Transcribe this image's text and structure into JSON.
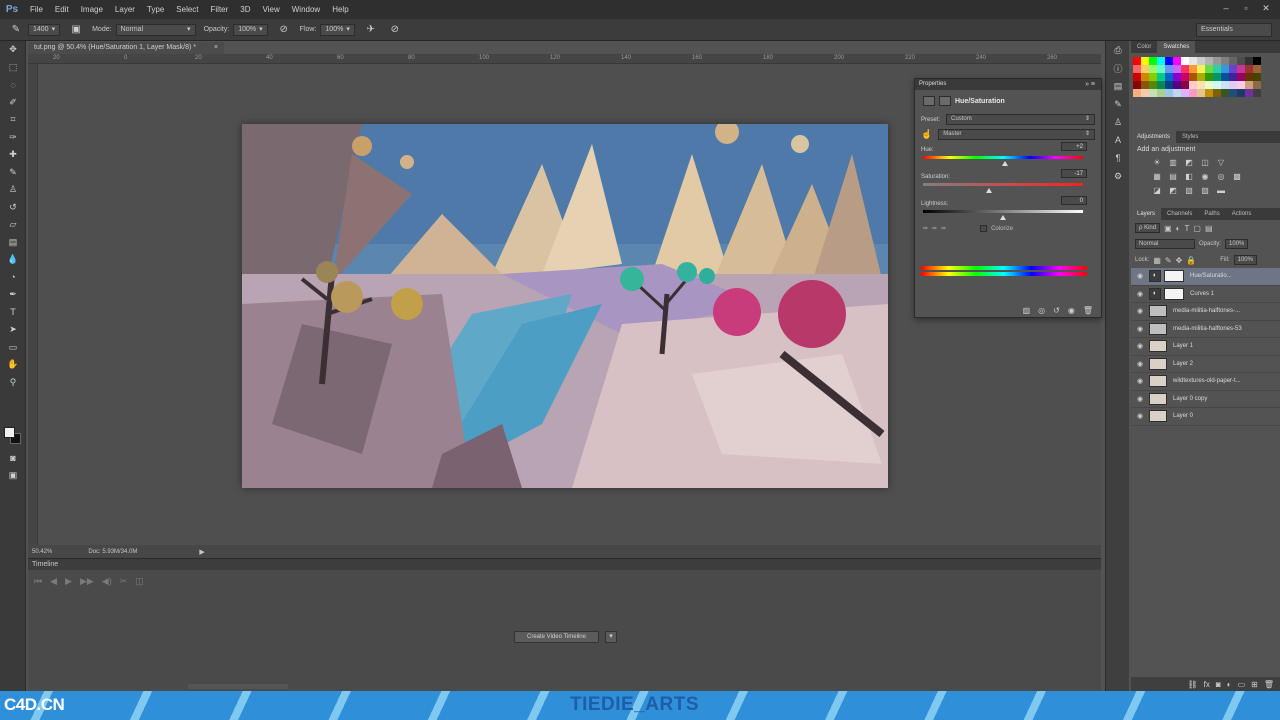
{
  "app": {
    "logo": "Ps"
  },
  "menu": [
    "File",
    "Edit",
    "Image",
    "Layer",
    "Type",
    "Select",
    "Filter",
    "3D",
    "View",
    "Window",
    "Help"
  ],
  "window_controls": [
    "–",
    "▫",
    "✕"
  ],
  "options_bar": {
    "brush_size": "1400",
    "mode_label": "Mode:",
    "mode_value": "Normal",
    "opacity_label": "Opacity:",
    "opacity_value": "100%",
    "flow_label": "Flow:",
    "flow_value": "100%",
    "workspace": "Essentials"
  },
  "document": {
    "tab_title": "tut.png @ 50.4% (Hue/Saturation 1, Layer Mask/8) *",
    "tab_close": "×",
    "ruler_ticks": [
      "20",
      "0",
      "20",
      "40",
      "60",
      "80",
      "100",
      "120",
      "140",
      "160",
      "180",
      "200",
      "220",
      "240",
      "260"
    ]
  },
  "status": {
    "zoom": "50.42%",
    "doc": "Doc: 5.93M/34.0M"
  },
  "timeline": {
    "title": "Timeline",
    "create_button": "Create Video Timeline"
  },
  "swatches_panel": {
    "tabs": [
      "Color",
      "Swatches"
    ],
    "colors": [
      "#ff0000",
      "#ffff00",
      "#00ff00",
      "#00ffff",
      "#0000ff",
      "#ff00ff",
      "#ffffff",
      "#e6e6e6",
      "#cccccc",
      "#b3b3b3",
      "#999999",
      "#808080",
      "#666666",
      "#4d4d4d",
      "#333333",
      "#000000",
      "#ff6666",
      "#ffcc66",
      "#99ff66",
      "#66ffcc",
      "#6699ff",
      "#cc66ff",
      "#ff3366",
      "#ff9933",
      "#ffee55",
      "#66dd44",
      "#33ccaa",
      "#3399dd",
      "#6644cc",
      "#cc3399",
      "#993333",
      "#996633",
      "#cc0000",
      "#cc8800",
      "#88cc00",
      "#00cc88",
      "#0066cc",
      "#8800cc",
      "#cc0066",
      "#aa5500",
      "#aaaa00",
      "#339900",
      "#009966",
      "#005599",
      "#442299",
      "#990066",
      "#663300",
      "#444400",
      "#880000",
      "#885500",
      "#558800",
      "#008855",
      "#004488",
      "#550088",
      "#880044",
      "#ffcccc",
      "#ffe0b3",
      "#e6ffcc",
      "#ccffee",
      "#cce0ff",
      "#e0ccff",
      "#ffcce6",
      "#c8a27a",
      "#8a6a4a",
      "#f4b183",
      "#f8cbad",
      "#c5e0b4",
      "#a9d18e",
      "#9dc3e6",
      "#bdd7ee",
      "#d9b3ff",
      "#ff99cc",
      "#e2c48d",
      "#bf9000",
      "#7f6000",
      "#375623",
      "#1f4e79",
      "#203864",
      "#7030a0",
      "#3f3f3f"
    ]
  },
  "adjustments_panel": {
    "tabs": [
      "Adjustments",
      "Styles"
    ],
    "title": "Add an adjustment",
    "row1": [
      "☀",
      "▥",
      "◩",
      "◫",
      "▽"
    ],
    "row2": [
      "▦",
      "▤",
      "◧",
      "◉",
      "◎",
      "▩"
    ],
    "row3": [
      "◪",
      "◩",
      "▧",
      "▨",
      "▬"
    ]
  },
  "layers_panel": {
    "tabs": [
      "Layers",
      "Channels",
      "Paths",
      "Actions"
    ],
    "kind": "ρ Kind",
    "blend_mode": "Normal",
    "opacity_label": "Opacity:",
    "opacity_value": "100%",
    "lock_label": "Lock:",
    "fill_label": "Fill:",
    "fill_value": "100%",
    "layers": [
      {
        "name": "Hue/Saturatio...",
        "type": "adjustment",
        "selected": true
      },
      {
        "name": "Curves 1",
        "type": "adjustment",
        "selected": false
      },
      {
        "name": "media-militia-halftones-...",
        "type": "smart",
        "selected": false
      },
      {
        "name": "media-militia-halftones-53",
        "type": "smart",
        "selected": false
      },
      {
        "name": "Layer 1",
        "type": "pixel",
        "selected": false
      },
      {
        "name": "Layer 2",
        "type": "pixel",
        "selected": false
      },
      {
        "name": "wildtextures-old-paper-t...",
        "type": "pixel",
        "selected": false
      },
      {
        "name": "Layer 0 copy",
        "type": "pixel",
        "selected": false
      },
      {
        "name": "Layer 0",
        "type": "pixel",
        "selected": false
      }
    ]
  },
  "properties_panel": {
    "header": "Properties",
    "title": "Hue/Saturation",
    "preset_label": "Preset:",
    "preset_value": "Custom",
    "channel_value": "Master",
    "hue_label": "Hue:",
    "hue_value": "+2",
    "saturation_label": "Saturation:",
    "saturation_value": "-17",
    "lightness_label": "Lightness:",
    "lightness_value": "0",
    "colorize_label": "Colorize",
    "hue_fraction": 0.51,
    "saturation_fraction": 0.415,
    "lightness_fraction": 0.5
  },
  "watermark": {
    "left": "C4D.CN",
    "center": "TIEDIE_ARTS"
  },
  "colors": {
    "menu_bg": "#2f2f2f",
    "panel_bg": "#535353",
    "selected_layer": "#6e7685",
    "banner": "#2f8fd8"
  }
}
